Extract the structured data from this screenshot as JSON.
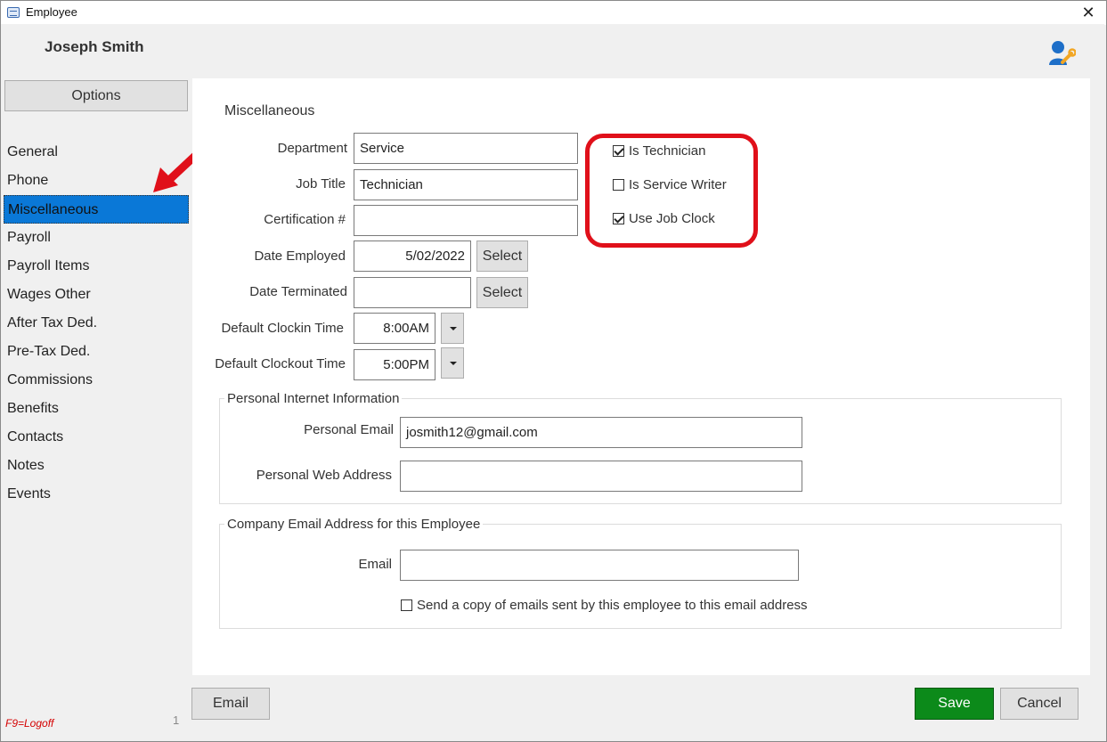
{
  "window": {
    "title": "Employee"
  },
  "header": {
    "employee_name": "Joseph Smith"
  },
  "sidebar": {
    "options_label": "Options",
    "items": [
      {
        "label": "General"
      },
      {
        "label": "Phone"
      },
      {
        "label": "Miscellaneous",
        "active": true
      },
      {
        "label": "Payroll"
      },
      {
        "label": "Payroll Items"
      },
      {
        "label": "Wages Other"
      },
      {
        "label": "After Tax Ded."
      },
      {
        "label": "Pre-Tax Ded."
      },
      {
        "label": "Commissions"
      },
      {
        "label": "Benefits"
      },
      {
        "label": "Contacts"
      },
      {
        "label": "Notes"
      },
      {
        "label": "Events"
      }
    ],
    "logoff_hint": "F9=Logoff",
    "page_number": "1"
  },
  "misc": {
    "section_title": "Miscellaneous",
    "department": {
      "label": "Department",
      "value": "Service"
    },
    "job_title": {
      "label": "Job Title",
      "value": "Technician"
    },
    "certification": {
      "label": "Certification #",
      "value": ""
    },
    "date_employed": {
      "label": "Date Employed",
      "value": "5/02/2022",
      "button": "Select"
    },
    "date_terminated": {
      "label": "Date Terminated",
      "value": "",
      "button": "Select"
    },
    "clockin": {
      "label": "Default Clockin Time",
      "value": "8:00AM"
    },
    "clockout": {
      "label": "Default Clockout Time",
      "value": "5:00PM"
    },
    "flags": {
      "is_technician": {
        "label": "Is Technician",
        "checked": true
      },
      "is_service_writer": {
        "label": "Is Service Writer",
        "checked": false
      },
      "use_job_clock": {
        "label": "Use Job Clock",
        "checked": true
      }
    }
  },
  "personal_internet": {
    "group_title": "Personal Internet Information",
    "email": {
      "label": "Personal Email",
      "value": "josmith12@gmail.com"
    },
    "web": {
      "label": "Personal Web Address",
      "value": ""
    }
  },
  "company_email": {
    "group_title": "Company Email Address for this Employee",
    "email": {
      "label": "Email",
      "value": ""
    },
    "send_copy": {
      "label": "Send a copy of emails sent by this employee to this email address",
      "checked": false
    }
  },
  "footer": {
    "email_label": "Email",
    "save_label": "Save",
    "cancel_label": "Cancel"
  },
  "colors": {
    "save": "#0c8a1a",
    "selected_nav": "#0a78d7",
    "highlight": "#e0101a"
  }
}
